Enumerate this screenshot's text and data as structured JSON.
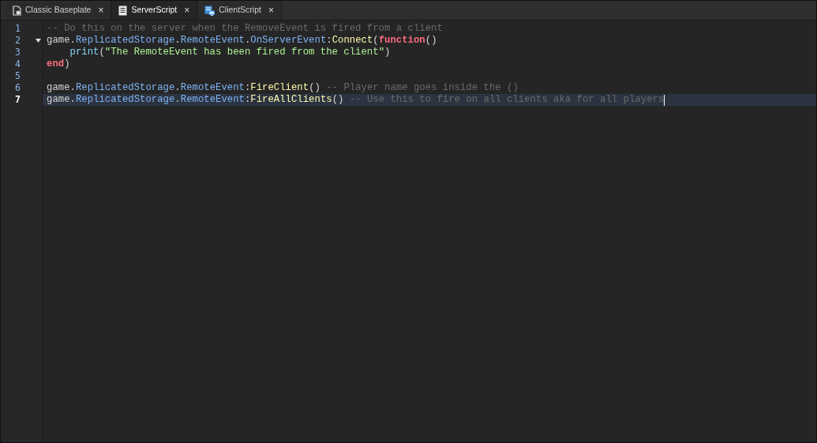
{
  "tabs": [
    {
      "label": "Classic Baseplate",
      "kind": "place",
      "selected": false,
      "close": "×"
    },
    {
      "label": "ServerScript",
      "kind": "script",
      "selected": true,
      "close": "×"
    },
    {
      "label": "ClientScript",
      "kind": "client",
      "selected": false,
      "close": "×"
    }
  ],
  "editor": {
    "lines": [
      {
        "number": "1",
        "current": false,
        "cursor": false,
        "tokens": [
          {
            "text": "-- Do this on the server when the RemoveEvent is fired from a client",
            "kind": "comment"
          }
        ]
      },
      {
        "number": "2",
        "current": false,
        "cursor": false,
        "fold": {
          "expanded": true
        },
        "tokens": [
          {
            "text": "game.",
            "kind": "plain"
          },
          {
            "text": "ReplicatedStorage",
            "kind": "property"
          },
          {
            "text": ".",
            "kind": "plain"
          },
          {
            "text": "RemoteEvent",
            "kind": "property"
          },
          {
            "text": ".",
            "kind": "plain"
          },
          {
            "text": "OnServerEvent",
            "kind": "property"
          },
          {
            "text": ":",
            "kind": "plain"
          },
          {
            "text": "Connect",
            "kind": "method"
          },
          {
            "text": "(",
            "kind": "plain"
          },
          {
            "text": "function",
            "kind": "keyword"
          },
          {
            "text": "()",
            "kind": "plain"
          }
        ]
      },
      {
        "number": "3",
        "current": false,
        "cursor": false,
        "indented": true,
        "tokens": [
          {
            "text": "print",
            "kind": "builtin"
          },
          {
            "text": "(",
            "kind": "plain"
          },
          {
            "text": "\"The RemoteEvent has been fired from the client\"",
            "kind": "string"
          },
          {
            "text": ")",
            "kind": "plain"
          }
        ]
      },
      {
        "number": "4",
        "current": false,
        "cursor": false,
        "tokens": [
          {
            "text": "end",
            "kind": "keyword"
          },
          {
            "text": ")",
            "kind": "plain"
          }
        ]
      },
      {
        "number": "5",
        "current": false,
        "cursor": false
      },
      {
        "number": "6",
        "current": false,
        "cursor": false,
        "tokens": [
          {
            "text": "game.",
            "kind": "plain"
          },
          {
            "text": "ReplicatedStorage",
            "kind": "property"
          },
          {
            "text": ".",
            "kind": "plain"
          },
          {
            "text": "RemoteEvent",
            "kind": "property"
          },
          {
            "text": ":",
            "kind": "plain"
          },
          {
            "text": "FireClient",
            "kind": "method"
          },
          {
            "text": "() ",
            "kind": "plain"
          },
          {
            "text": "-- Player name goes inside the ()",
            "kind": "comment"
          }
        ]
      },
      {
        "number": "7",
        "current": true,
        "cursor": true,
        "tokens": [
          {
            "text": "game.",
            "kind": "plain"
          },
          {
            "text": "ReplicatedStorage",
            "kind": "property"
          },
          {
            "text": ".",
            "kind": "plain"
          },
          {
            "text": "RemoteEvent",
            "kind": "property"
          },
          {
            "text": ":",
            "kind": "plain"
          },
          {
            "text": "FireAllClients",
            "kind": "method"
          },
          {
            "text": "() ",
            "kind": "plain"
          },
          {
            "text": "-- Use this to fire on all clients aka for all players",
            "kind": "comment"
          }
        ]
      }
    ]
  }
}
